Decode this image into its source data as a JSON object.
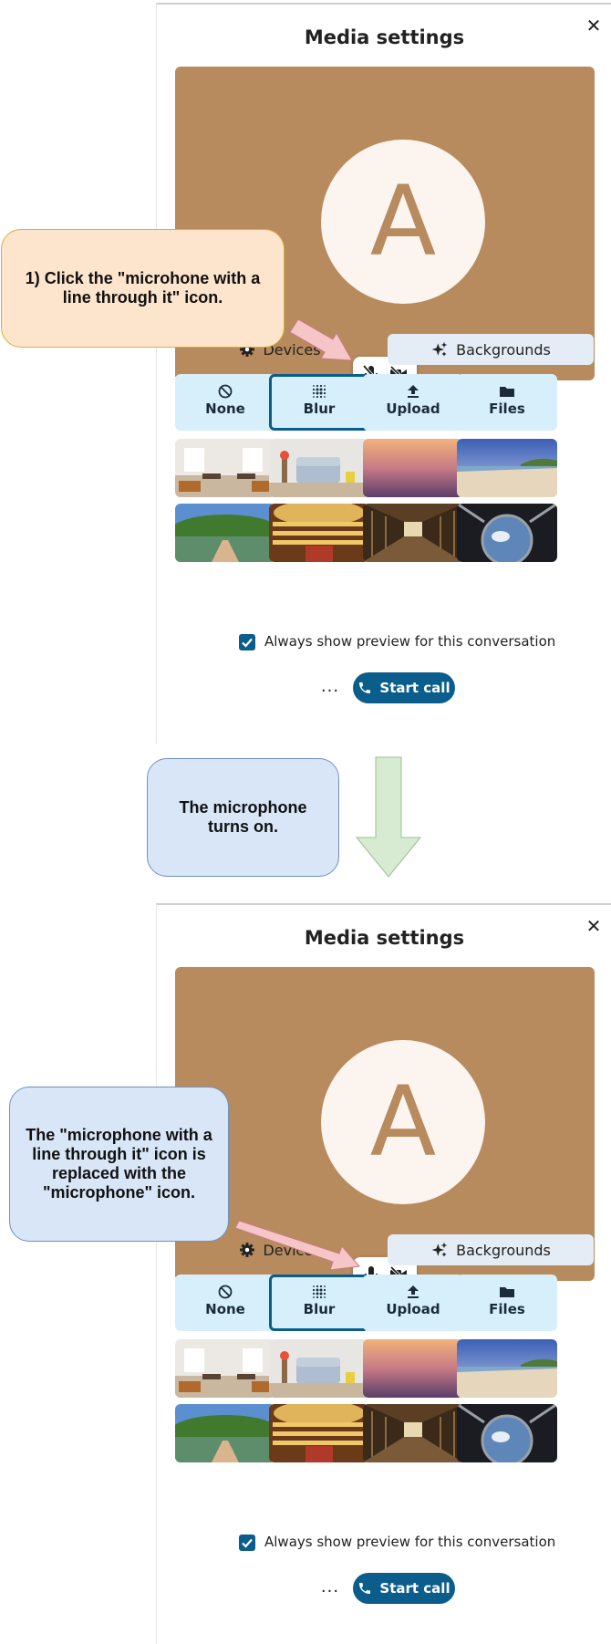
{
  "panels": [
    {
      "id": "before",
      "dialog_title": "Media settings",
      "avatar_letter": "A",
      "mic_icon": "microphone-off-icon",
      "video_icon": "video-off-icon",
      "tabs": {
        "devices": "Devices",
        "backgrounds": "Backgrounds"
      },
      "options": [
        "None",
        "Blur",
        "Upload",
        "Files"
      ],
      "selected_option": "Blur",
      "preview_checkbox": {
        "label": "Always show preview for this conversation",
        "checked": true
      },
      "more_label": "...",
      "start_call_label": "Start call"
    },
    {
      "id": "after",
      "dialog_title": "Media settings",
      "avatar_letter": "A",
      "mic_icon": "microphone-icon",
      "video_icon": "video-off-icon",
      "tabs": {
        "devices": "Devices",
        "backgrounds": "Backgrounds"
      },
      "options": [
        "None",
        "Blur",
        "Upload",
        "Files"
      ],
      "selected_option": "Blur",
      "preview_checkbox": {
        "label": "Always show preview for this conversation",
        "checked": true
      },
      "more_label": "...",
      "start_call_label": "Start call"
    }
  ],
  "background_thumbnails": [
    "office-room",
    "living-room-sofa",
    "sunset-gradient",
    "beach",
    "garden-bridge",
    "theater",
    "library-hall",
    "space-station"
  ],
  "callouts": {
    "step1": "1) Click the \"microhone with a line through it\" icon.",
    "result": "The microphone turns on.",
    "change": "The \"microphone with a line through it\" icon is replaced with the \"microphone\" icon."
  },
  "colors": {
    "preview_background": "#b88b5e",
    "avatar_background": "#fbf4ef",
    "accent": "#0b5d8b",
    "option_background": "#d6effb",
    "step_callout": "#fde4cc",
    "info_callout": "#d8e6f8",
    "flow_arrow": "#d7ead2",
    "pointer_arrow": "#f6c5c8"
  }
}
